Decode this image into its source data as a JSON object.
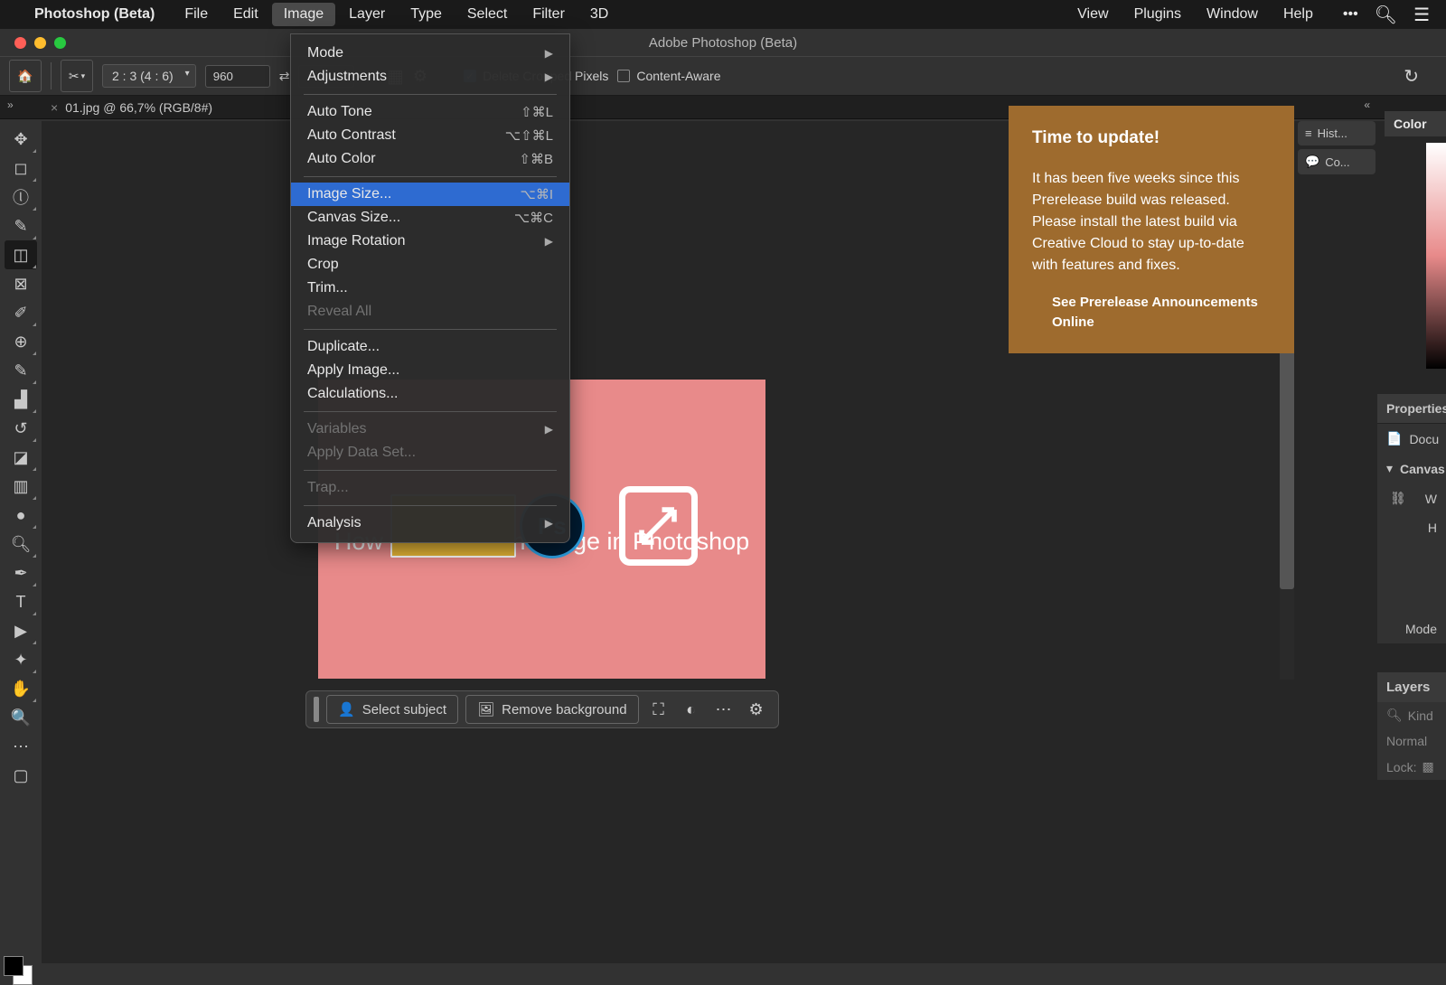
{
  "menubar": {
    "app_name": "Photoshop (Beta)",
    "items": [
      "File",
      "Edit",
      "Image",
      "Layer",
      "Type",
      "Select",
      "Filter",
      "3D"
    ],
    "right_items": [
      "View",
      "Plugins",
      "Window",
      "Help"
    ],
    "active_index": 2
  },
  "window_title": "Adobe Photoshop (Beta)",
  "options_bar": {
    "ratio_preset": "2 : 3 (4 : 6)",
    "width_value": "960",
    "delete_cropped": "Delete Cropped Pixels",
    "content_aware": "Content-Aware"
  },
  "document_tab": {
    "title": "01.jpg @ 66,7% (RGB/8#)"
  },
  "image_menu": {
    "groups": [
      [
        {
          "label": "Mode",
          "arrow": true
        },
        {
          "label": "Adjustments",
          "arrow": true
        }
      ],
      [
        {
          "label": "Auto Tone",
          "shortcut": "⇧⌘L"
        },
        {
          "label": "Auto Contrast",
          "shortcut": "⌥⇧⌘L"
        },
        {
          "label": "Auto Color",
          "shortcut": "⇧⌘B"
        }
      ],
      [
        {
          "label": "Image Size...",
          "shortcut": "⌥⌘I",
          "selected": true
        },
        {
          "label": "Canvas Size...",
          "shortcut": "⌥⌘C"
        },
        {
          "label": "Image Rotation",
          "arrow": true
        },
        {
          "label": "Crop"
        },
        {
          "label": "Trim..."
        },
        {
          "label": "Reveal All",
          "disabled": true
        }
      ],
      [
        {
          "label": "Duplicate..."
        },
        {
          "label": "Apply Image..."
        },
        {
          "label": "Calculations..."
        }
      ],
      [
        {
          "label": "Variables",
          "arrow": true,
          "disabled": true
        },
        {
          "label": "Apply Data Set...",
          "disabled": true
        }
      ],
      [
        {
          "label": "Trap...",
          "disabled": true
        }
      ],
      [
        {
          "label": "Analysis",
          "arrow": true
        }
      ]
    ]
  },
  "notification": {
    "title": "Time to update!",
    "body": "It has been five weeks since this Prerelease build was released. Please install the latest build via Creative Cloud to stay up-to-date with features and fixes.",
    "link": "See Prerelease Announcements Online"
  },
  "canvas_content": {
    "headline": "How to Resize an Image in Photoshop",
    "ps_badge": "Ps"
  },
  "context_bar": {
    "select_subject": "Select subject",
    "remove_bg": "Remove background"
  },
  "right_tabs": {
    "hist": "Hist...",
    "com": "Co...",
    "color": "Color",
    "properties": "Properties",
    "docu": "Docu",
    "canvas": "Canvas",
    "w": "W",
    "h": "H",
    "mode": "Mode",
    "layers": "Layers",
    "kind": "Kind",
    "normal": "Normal",
    "lock": "Lock:"
  },
  "icons": {
    "search": "⌕",
    "more": "•••",
    "hamburger": "≡"
  }
}
